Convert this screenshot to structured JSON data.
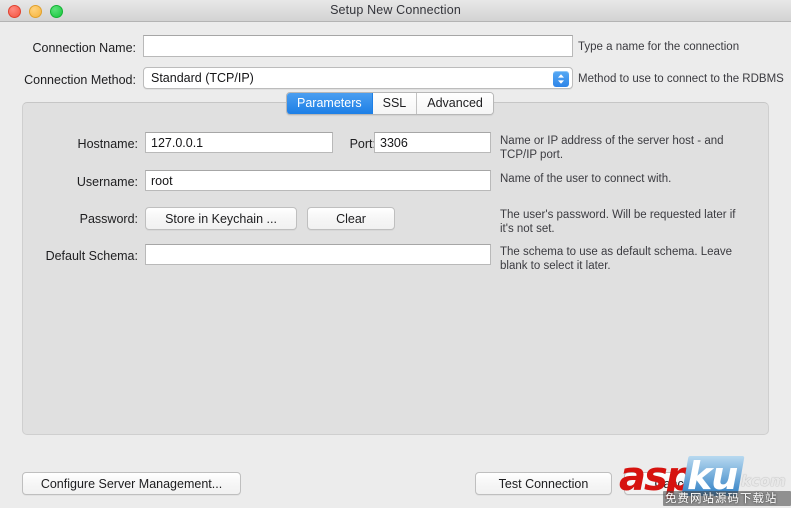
{
  "window": {
    "title": "Setup New Connection",
    "traffic_lights": [
      "close",
      "minimize",
      "maximize"
    ]
  },
  "form": {
    "connection_name": {
      "label": "Connection Name:",
      "value": "",
      "placeholder": "",
      "help": "Type a name for the connection"
    },
    "connection_method": {
      "label": "Connection Method:",
      "value": "Standard (TCP/IP)",
      "help": "Method to use to connect to the RDBMS",
      "options": [
        "Standard (TCP/IP)"
      ]
    }
  },
  "tabs": [
    {
      "label": "Parameters",
      "active": true
    },
    {
      "label": "SSL",
      "active": false
    },
    {
      "label": "Advanced",
      "active": false
    }
  ],
  "parameters": {
    "hostname": {
      "label": "Hostname:",
      "value": "127.0.0.1",
      "help": "Name or IP address of the server host - and TCP/IP port."
    },
    "port": {
      "label": "Port:",
      "value": "3306"
    },
    "username": {
      "label": "Username:",
      "value": "root",
      "help": "Name of the user to connect with."
    },
    "password": {
      "label": "Password:",
      "store_button": "Store in Keychain ...",
      "clear_button": "Clear",
      "help": "The user's password. Will be requested later if it's not set."
    },
    "default_schema": {
      "label": "Default Schema:",
      "value": "",
      "help": "The schema to use as default schema. Leave blank to select it later."
    }
  },
  "footer": {
    "configure_button": "Configure Server Management...",
    "test_button": "Test Connection",
    "cancel_button": "Cancel"
  },
  "watermark": {
    "asp": "asp",
    "ku": "ku",
    "com": "kcom",
    "subtitle": "免费网站源码下载站"
  },
  "colors": {
    "accent_blue": "#1d7fe6",
    "window_bg": "#ececec",
    "panel_bg": "#e0e0e0",
    "watermark_red": "#d6130f"
  }
}
